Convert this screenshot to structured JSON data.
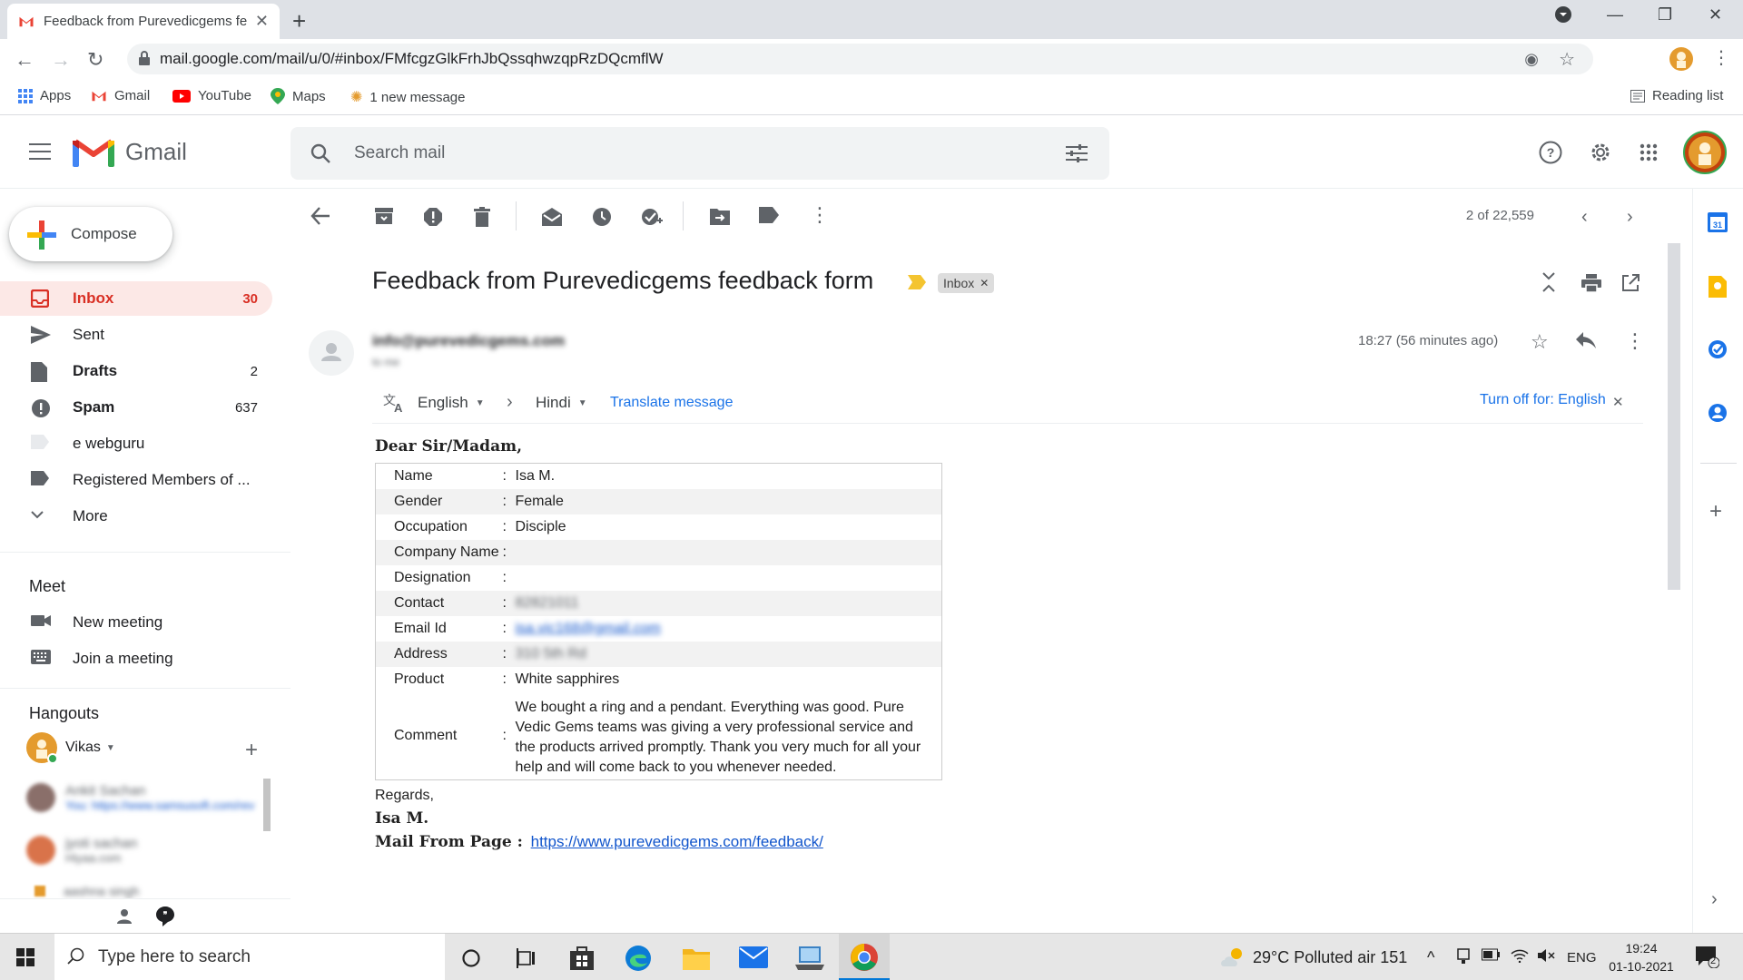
{
  "browser": {
    "tab_title": "Feedback from Purevedicgems fe",
    "url": "mail.google.com/mail/u/0/#inbox/FMfcgzGlkFrhJbQssqhwzqpRzDQcmflW",
    "reading_list": "Reading list",
    "bookmarks": [
      "Apps",
      "Gmail",
      "YouTube",
      "Maps",
      "1 new message"
    ]
  },
  "gmail": {
    "logo_text": "Gmail",
    "search_placeholder": "Search mail",
    "compose": "Compose",
    "nav": [
      {
        "label": "Inbox",
        "count": "30"
      },
      {
        "label": "Sent",
        "count": ""
      },
      {
        "label": "Drafts",
        "count": "2"
      },
      {
        "label": "Spam",
        "count": "637"
      },
      {
        "label": "e webguru",
        "count": ""
      },
      {
        "label": "Registered Members of ...",
        "count": ""
      },
      {
        "label": "More",
        "count": ""
      }
    ],
    "meet": {
      "title": "Meet",
      "new_meeting": "New meeting",
      "join": "Join a meeting"
    },
    "hangouts": {
      "title": "Hangouts",
      "user": "Vikas",
      "contacts": [
        {
          "name": "Ankit Sachan",
          "preview": "You: https://www.samsusoft.com/rev"
        },
        {
          "name": "jyoti sachan",
          "preview": "Hiyaa.com"
        },
        {
          "name": "aashna singh",
          "preview": ""
        }
      ]
    },
    "pager": "2 of 22,559"
  },
  "email": {
    "subject": "Feedback from Purevedicgems feedback form",
    "label": "Inbox",
    "sender": "info@purevedicgems.com",
    "to": "to me",
    "time": "18:27 (56 minutes ago)",
    "translate": {
      "from": "English",
      "to": "Hindi",
      "action": "Translate message",
      "turn_off": "Turn off for: English"
    },
    "greeting": "Dear Sir/Madam,",
    "fields": [
      {
        "key": "Name",
        "value": "Isa M."
      },
      {
        "key": "Gender",
        "value": "Female"
      },
      {
        "key": "Occupation",
        "value": "Disciple"
      },
      {
        "key": "Company Name",
        "value": ""
      },
      {
        "key": "Designation",
        "value": ""
      },
      {
        "key": "Contact",
        "value": "82821011"
      },
      {
        "key": "Email Id",
        "value": "isa.vic168@gmail.com"
      },
      {
        "key": "Address",
        "value": "310 5th Rd"
      },
      {
        "key": "Product",
        "value": "White sapphires"
      }
    ],
    "comment_key": "Comment",
    "comment": "We bought a ring and a pendant. Everything was good. Pure Vedic Gems teams was giving a very professional service and the products arrived promptly. Thank you very much for all your help and will come back to you whenever needed.",
    "regards": "Regards,",
    "signature": "Isa M.",
    "mail_from_label": "Mail From Page :",
    "mail_from_url": "https://www.purevedicgems.com/feedback/"
  },
  "taskbar": {
    "search": "Type here to search",
    "weather": "29°C  Polluted air 151",
    "lang": "ENG",
    "time": "19:24",
    "date": "01-10-2021",
    "notif": "2"
  }
}
